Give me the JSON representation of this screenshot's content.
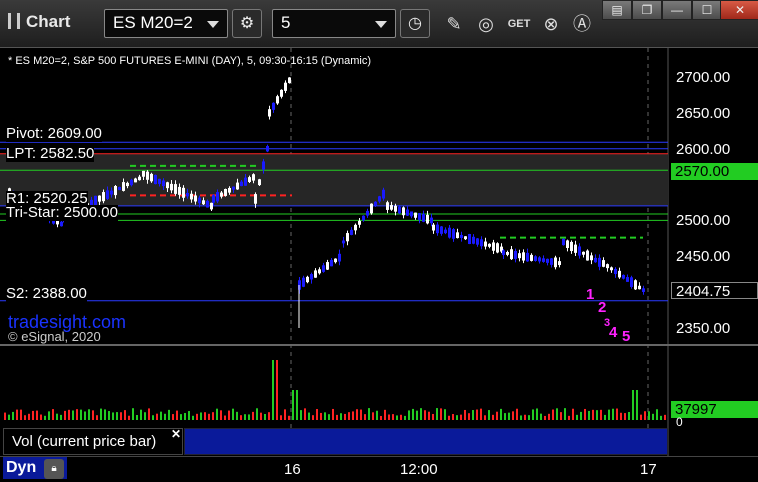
{
  "window": {
    "title": "Chart",
    "symbol_dropdown": "ES M20=2",
    "interval_dropdown": "5",
    "toolbar_icons": [
      "settings-icon",
      "clock-icon",
      "pencil-icon",
      "study-icon",
      "get-icon",
      "close-circle-icon",
      "cursor-a-icon"
    ],
    "window_buttons": [
      "menu-icon",
      "restore-icon",
      "minimize-icon",
      "maximize-icon",
      "close-icon"
    ]
  },
  "chart_header": "* ES M20=2, S&P 500 FUTURES E-MINI (DAY), 5, 09:30-16:15 (Dynamic)",
  "levels": {
    "pivot": "Pivot: 2609.00",
    "lpt": "LPT: 2582.50",
    "r1": "R1: 2520.25",
    "tri_star": "Tri-Star: 2500.00",
    "s2": "S2: 2388.00"
  },
  "watermark": "tradesight.com",
  "copyright": "© eSignal, 2020",
  "price_axis": {
    "ticks": [
      "2700.00",
      "2650.00",
      "2600.00",
      "2550.00",
      "2500.00",
      "2450.00",
      "2400.00",
      "2350.00"
    ],
    "badge_green": "2570.00",
    "badge_current": "2404.75"
  },
  "volume": {
    "label": "Vol (current price bar)",
    "value_badge": "37997",
    "zero_label": "0"
  },
  "x_axis": {
    "labels": [
      "16",
      "12:00",
      "17"
    ]
  },
  "status": {
    "dyn": "Dyn"
  },
  "setup_numbers": [
    "1",
    "2",
    "3",
    "4",
    "5"
  ],
  "colors": {
    "up_candle": "#ffffff",
    "down_candle": "#1a1aff",
    "green_line": "#22cc22",
    "red_line": "#ff2222",
    "blue_line": "#2a3aff",
    "badge_green": "#22cc22",
    "magenta": "#ff22ff"
  },
  "chart_data": {
    "type": "candlestick",
    "title": "* ES M20=2, S&P 500 FUTURES E-MINI (DAY), 5, 09:30-16:15 (Dynamic)",
    "ylim": [
      2330,
      2720
    ],
    "y_ticks": [
      2700,
      2650,
      2600,
      2550,
      2500,
      2450,
      2400,
      2350
    ],
    "x_labels": [
      "16",
      "12:00",
      "17"
    ],
    "horizontal_levels": [
      {
        "value": 2609.0,
        "color": "#2a3aff"
      },
      {
        "value": 2593.0,
        "color": "#ff2222"
      },
      {
        "value": 2600.0,
        "color": "#2a3aff"
      },
      {
        "value": 2570.0,
        "color": "#22cc22"
      },
      {
        "value": 2520.25,
        "color": "#2a3aff"
      },
      {
        "value": 2509.0,
        "color": "#22cc22"
      },
      {
        "value": 2500.0,
        "color": "#22cc22"
      },
      {
        "value": 2388.0,
        "color": "#2a3aff"
      }
    ],
    "current_price": 2404.75,
    "volume_last": 37997
  }
}
